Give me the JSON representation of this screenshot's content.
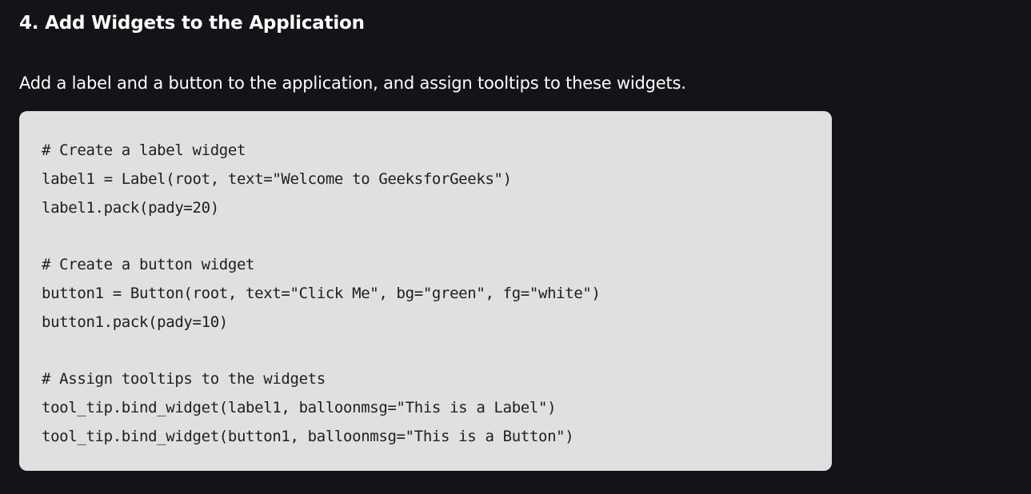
{
  "article": {
    "heading": "4. Add Widgets to the Application",
    "intro": "Add a label and a button to the application, and assign tooltips to these widgets."
  },
  "code": {
    "lines": [
      "# Create a label widget",
      "label1 = Label(root, text=\"Welcome to GeeksforGeeks\")",
      "label1.pack(pady=20)",
      "",
      "# Create a button widget",
      "button1 = Button(root, text=\"Click Me\", bg=\"green\", fg=\"white\")",
      "button1.pack(pady=10)",
      "",
      "# Assign tooltips to the widgets",
      "tool_tip.bind_widget(label1, balloonmsg=\"This is a Label\")",
      "tool_tip.bind_widget(button1, balloonmsg=\"This is a Button\")"
    ]
  },
  "colors": {
    "page_background": "#131417",
    "code_background": "#e0e0e0",
    "code_text": "#1e1e1e",
    "text": "#ffffff"
  }
}
